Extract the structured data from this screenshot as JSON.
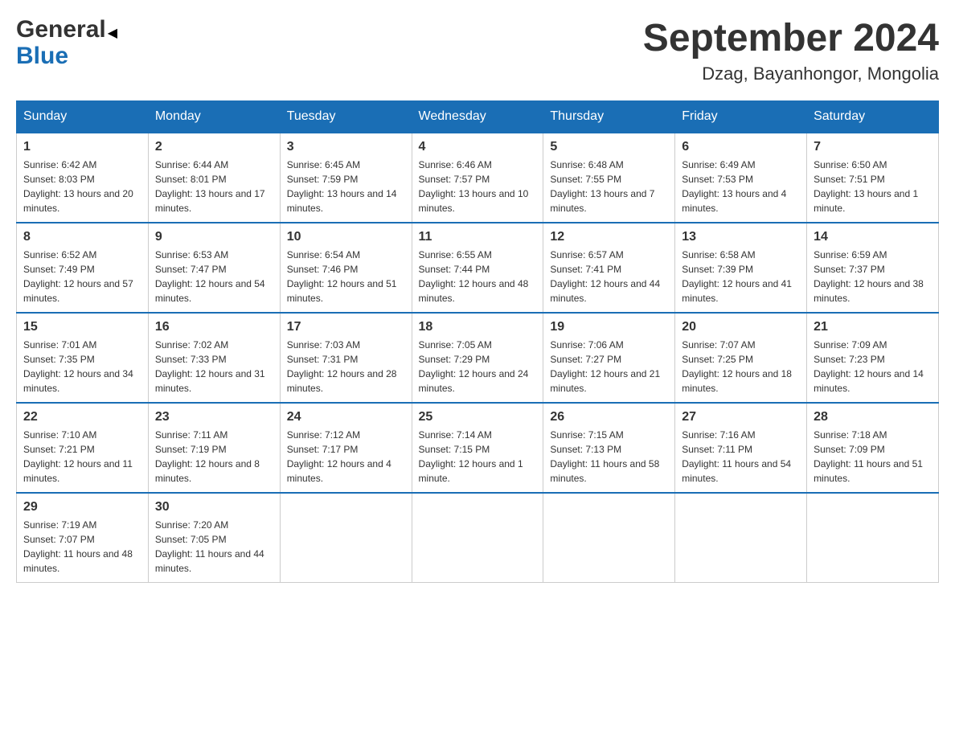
{
  "header": {
    "logo_general": "General",
    "logo_blue": "Blue",
    "month_year": "September 2024",
    "location": "Dzag, Bayanhongor, Mongolia"
  },
  "days_of_week": [
    "Sunday",
    "Monday",
    "Tuesday",
    "Wednesday",
    "Thursday",
    "Friday",
    "Saturday"
  ],
  "weeks": [
    [
      {
        "day": "1",
        "sunrise": "6:42 AM",
        "sunset": "8:03 PM",
        "daylight": "13 hours and 20 minutes."
      },
      {
        "day": "2",
        "sunrise": "6:44 AM",
        "sunset": "8:01 PM",
        "daylight": "13 hours and 17 minutes."
      },
      {
        "day": "3",
        "sunrise": "6:45 AM",
        "sunset": "7:59 PM",
        "daylight": "13 hours and 14 minutes."
      },
      {
        "day": "4",
        "sunrise": "6:46 AM",
        "sunset": "7:57 PM",
        "daylight": "13 hours and 10 minutes."
      },
      {
        "day": "5",
        "sunrise": "6:48 AM",
        "sunset": "7:55 PM",
        "daylight": "13 hours and 7 minutes."
      },
      {
        "day": "6",
        "sunrise": "6:49 AM",
        "sunset": "7:53 PM",
        "daylight": "13 hours and 4 minutes."
      },
      {
        "day": "7",
        "sunrise": "6:50 AM",
        "sunset": "7:51 PM",
        "daylight": "13 hours and 1 minute."
      }
    ],
    [
      {
        "day": "8",
        "sunrise": "6:52 AM",
        "sunset": "7:49 PM",
        "daylight": "12 hours and 57 minutes."
      },
      {
        "day": "9",
        "sunrise": "6:53 AM",
        "sunset": "7:47 PM",
        "daylight": "12 hours and 54 minutes."
      },
      {
        "day": "10",
        "sunrise": "6:54 AM",
        "sunset": "7:46 PM",
        "daylight": "12 hours and 51 minutes."
      },
      {
        "day": "11",
        "sunrise": "6:55 AM",
        "sunset": "7:44 PM",
        "daylight": "12 hours and 48 minutes."
      },
      {
        "day": "12",
        "sunrise": "6:57 AM",
        "sunset": "7:41 PM",
        "daylight": "12 hours and 44 minutes."
      },
      {
        "day": "13",
        "sunrise": "6:58 AM",
        "sunset": "7:39 PM",
        "daylight": "12 hours and 41 minutes."
      },
      {
        "day": "14",
        "sunrise": "6:59 AM",
        "sunset": "7:37 PM",
        "daylight": "12 hours and 38 minutes."
      }
    ],
    [
      {
        "day": "15",
        "sunrise": "7:01 AM",
        "sunset": "7:35 PM",
        "daylight": "12 hours and 34 minutes."
      },
      {
        "day": "16",
        "sunrise": "7:02 AM",
        "sunset": "7:33 PM",
        "daylight": "12 hours and 31 minutes."
      },
      {
        "day": "17",
        "sunrise": "7:03 AM",
        "sunset": "7:31 PM",
        "daylight": "12 hours and 28 minutes."
      },
      {
        "day": "18",
        "sunrise": "7:05 AM",
        "sunset": "7:29 PM",
        "daylight": "12 hours and 24 minutes."
      },
      {
        "day": "19",
        "sunrise": "7:06 AM",
        "sunset": "7:27 PM",
        "daylight": "12 hours and 21 minutes."
      },
      {
        "day": "20",
        "sunrise": "7:07 AM",
        "sunset": "7:25 PM",
        "daylight": "12 hours and 18 minutes."
      },
      {
        "day": "21",
        "sunrise": "7:09 AM",
        "sunset": "7:23 PM",
        "daylight": "12 hours and 14 minutes."
      }
    ],
    [
      {
        "day": "22",
        "sunrise": "7:10 AM",
        "sunset": "7:21 PM",
        "daylight": "12 hours and 11 minutes."
      },
      {
        "day": "23",
        "sunrise": "7:11 AM",
        "sunset": "7:19 PM",
        "daylight": "12 hours and 8 minutes."
      },
      {
        "day": "24",
        "sunrise": "7:12 AM",
        "sunset": "7:17 PM",
        "daylight": "12 hours and 4 minutes."
      },
      {
        "day": "25",
        "sunrise": "7:14 AM",
        "sunset": "7:15 PM",
        "daylight": "12 hours and 1 minute."
      },
      {
        "day": "26",
        "sunrise": "7:15 AM",
        "sunset": "7:13 PM",
        "daylight": "11 hours and 58 minutes."
      },
      {
        "day": "27",
        "sunrise": "7:16 AM",
        "sunset": "7:11 PM",
        "daylight": "11 hours and 54 minutes."
      },
      {
        "day": "28",
        "sunrise": "7:18 AM",
        "sunset": "7:09 PM",
        "daylight": "11 hours and 51 minutes."
      }
    ],
    [
      {
        "day": "29",
        "sunrise": "7:19 AM",
        "sunset": "7:07 PM",
        "daylight": "11 hours and 48 minutes."
      },
      {
        "day": "30",
        "sunrise": "7:20 AM",
        "sunset": "7:05 PM",
        "daylight": "11 hours and 44 minutes."
      },
      null,
      null,
      null,
      null,
      null
    ]
  ]
}
